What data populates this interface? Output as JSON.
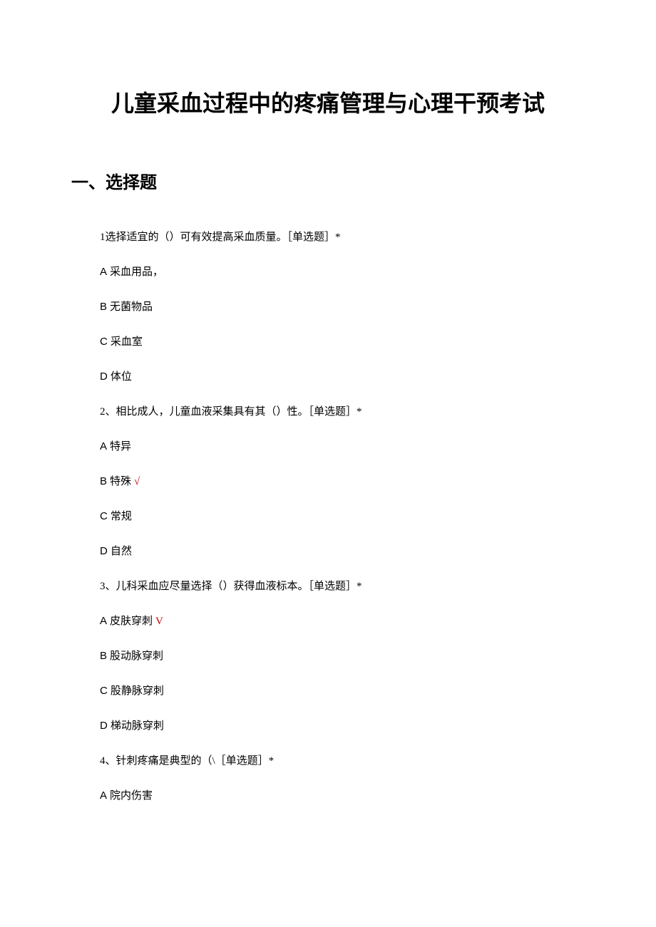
{
  "title": "儿童采血过程中的疼痛管理与心理干预考试",
  "section_heading": "一、选择题",
  "questions": [
    {
      "number": "1",
      "text": "选择适宜的（）可有效提高采血质量。［单选题］*",
      "options": [
        {
          "label": "A",
          "text": "采血用品，",
          "correct": false
        },
        {
          "label": "B",
          "text": "无菌物品",
          "correct": false
        },
        {
          "label": "C",
          "text": "采血室",
          "correct": false
        },
        {
          "label": "D",
          "text": "体位",
          "correct": false
        }
      ]
    },
    {
      "number": "2、",
      "text": "相比成人，儿童血液采集具有其（）性。［单选题］*",
      "options": [
        {
          "label": "A",
          "text": "特异",
          "correct": false
        },
        {
          "label": "B",
          "text": "特殊",
          "correct": true,
          "mark": "√"
        },
        {
          "label": "C",
          "text": "常规",
          "correct": false
        },
        {
          "label": "D",
          "text": "自然",
          "correct": false
        }
      ]
    },
    {
      "number": "3、",
      "text": "儿科采血应尽量选择（）获得血液标本。［单选题］*",
      "options": [
        {
          "label": "A",
          "text": "皮肤穿刺",
          "correct": true,
          "mark": "V"
        },
        {
          "label": "B",
          "text": "股动脉穿刺",
          "correct": false
        },
        {
          "label": "C",
          "text": "股静脉穿刺",
          "correct": false
        },
        {
          "label": "D",
          "text": "梯动脉穿刺",
          "correct": false
        }
      ]
    },
    {
      "number": "4、",
      "text": "针刺疼痛是典型的（\\［单选题］*",
      "options": [
        {
          "label": "A",
          "text": "院内伤害",
          "correct": false
        }
      ]
    }
  ]
}
